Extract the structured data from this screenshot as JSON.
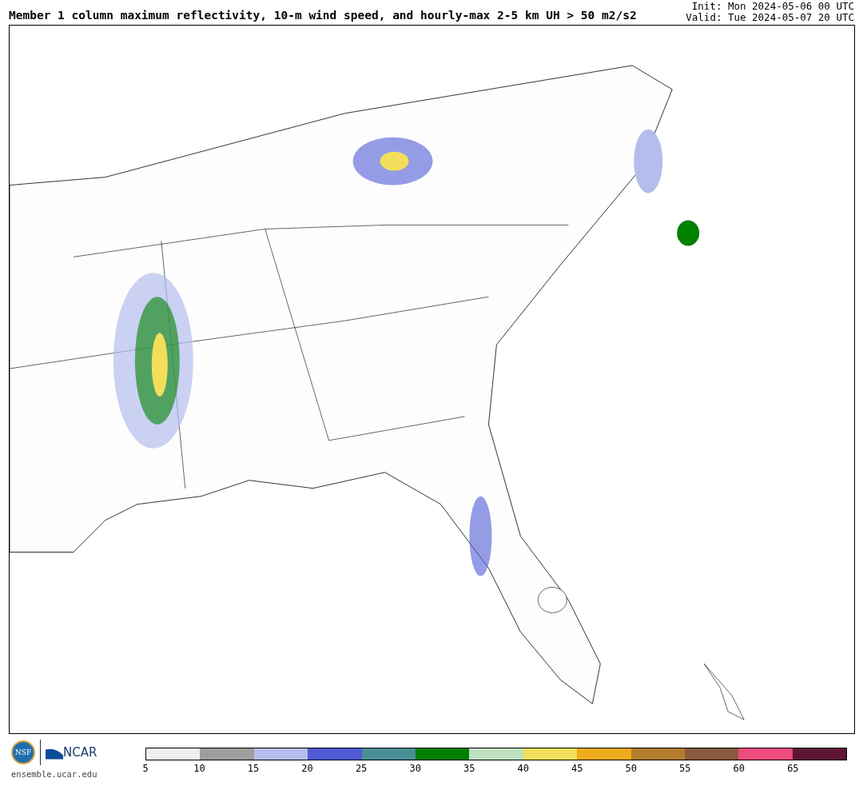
{
  "title": "Member 1 column maximum reflectivity, 10-m wind speed, and hourly-max 2-5 km UH > 50 m2/s2",
  "init": "Init: Mon 2024-05-06 00 UTC",
  "valid": "Valid: Tue 2024-05-07 20 UTC",
  "logos": {
    "nsf": "NSF",
    "ncar": "NCAR",
    "url": "ensemble.ucar.edu"
  },
  "colorbar": {
    "segments": [
      {
        "color": "#efefef",
        "label": "5"
      },
      {
        "color": "#9e9e9e",
        "label": "10"
      },
      {
        "color": "#b4bdec",
        "label": "15"
      },
      {
        "color": "#4f5bd5",
        "label": "20"
      },
      {
        "color": "#4a8f96",
        "label": "25"
      },
      {
        "color": "#008000",
        "label": "30"
      },
      {
        "color": "#bfe0c0",
        "label": "35"
      },
      {
        "color": "#f2de5a",
        "label": "40"
      },
      {
        "color": "#eeab1a",
        "label": "45"
      },
      {
        "color": "#b47d2d",
        "label": "50"
      },
      {
        "color": "#8a5a3e",
        "label": "55"
      },
      {
        "color": "#ee4c7c",
        "label": "60"
      },
      {
        "color": "#5e1535",
        "label": "65"
      }
    ]
  }
}
